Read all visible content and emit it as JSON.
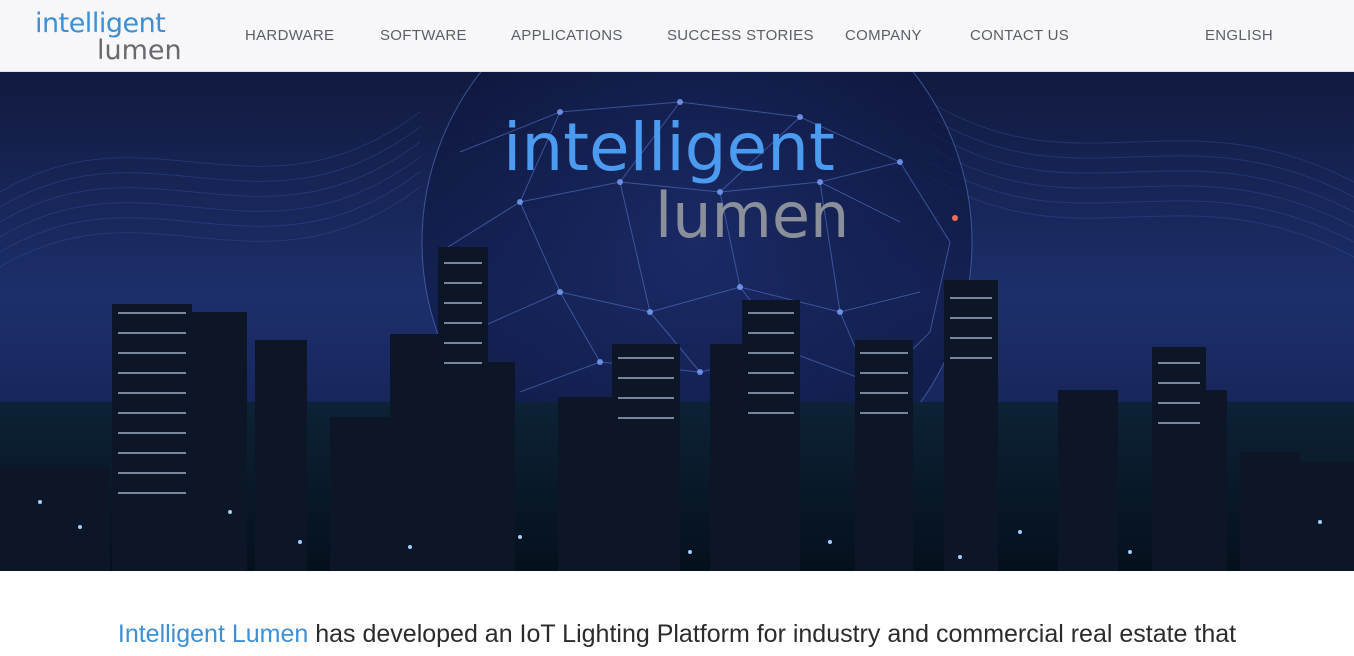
{
  "header": {
    "logo": {
      "line1": "intelligent",
      "line2": "lumen"
    },
    "nav": [
      {
        "label": "HARDWARE"
      },
      {
        "label": "SOFTWARE"
      },
      {
        "label": "APPLICATIONS"
      },
      {
        "label": "SUCCESS STORIES"
      },
      {
        "label": "COMPANY"
      },
      {
        "label": "CONTACT US"
      }
    ],
    "language": "ENGLISH"
  },
  "hero": {
    "logo": {
      "line1": "intelligent",
      "line2": "lumen"
    }
  },
  "intro": {
    "brand": "Intelligent Lumen",
    "text": " has developed an IoT Lighting Platform for industry and commercial real estate that"
  },
  "colors": {
    "accent": "#3d8fd6",
    "header_bg": "#f7f7f9",
    "nav_text": "#5a5f66",
    "hero_bg": "#0a1028"
  }
}
